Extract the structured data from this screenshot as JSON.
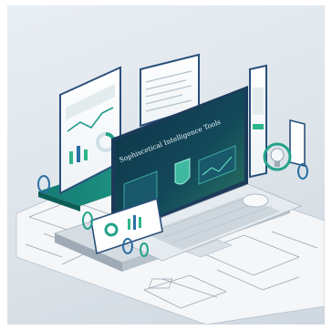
{
  "scene": {
    "screen_title": "Sophiscetical Intelligence Tools",
    "colors": {
      "background": "#dde4ea",
      "platform": "#c9d2d9",
      "teal": "#1d8c80",
      "navy": "#1d3a5a",
      "screen_dark": "#0f2a3b",
      "accent_green": "#2fb58a"
    },
    "icons": [
      "laptop-icon",
      "shield-icon",
      "lightbulb-icon",
      "mouse-icon",
      "bar-chart-icon",
      "donut-chart-icon"
    ]
  }
}
